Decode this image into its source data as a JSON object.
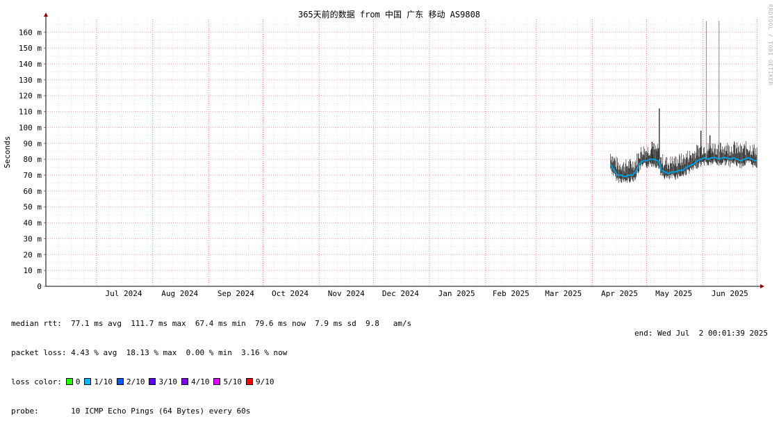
{
  "chart_data": {
    "type": "line",
    "title": "365天前的数据 from 中国 广东 移动 AS9808",
    "ylabel": "Seconds",
    "ylim": [
      0,
      168
    ],
    "y_unit": "ms",
    "y_ticks": [
      "0",
      "10 m",
      "20 m",
      "30 m",
      "40 m",
      "50 m",
      "60 m",
      "70 m",
      "80 m",
      "90 m",
      "100 m",
      "110 m",
      "120 m",
      "130 m",
      "140 m",
      "150 m",
      "160 m"
    ],
    "x_range": [
      "2024-06-03",
      "2025-07-02"
    ],
    "x_tick_labels": [
      {
        "date": "2024-07-16",
        "label": "Jul 2024"
      },
      {
        "date": "2024-08-16",
        "label": "Aug 2024"
      },
      {
        "date": "2024-09-16",
        "label": "Sep 2024"
      },
      {
        "date": "2024-10-16",
        "label": "Oct 2024"
      },
      {
        "date": "2024-11-16",
        "label": "Nov 2024"
      },
      {
        "date": "2024-12-16",
        "label": "Dec 2024"
      },
      {
        "date": "2025-01-16",
        "label": "Jan 2025"
      },
      {
        "date": "2025-02-15",
        "label": "Feb 2025"
      },
      {
        "date": "2025-03-16",
        "label": "Mar 2025"
      },
      {
        "date": "2025-04-16",
        "label": "Apr 2025"
      },
      {
        "date": "2025-05-16",
        "label": "May 2025"
      },
      {
        "date": "2025-06-16",
        "label": "Jun 2025"
      }
    ],
    "month_gridlines": [
      "2024-07-01",
      "2024-08-01",
      "2024-09-01",
      "2024-10-01",
      "2024-11-01",
      "2024-12-01",
      "2025-01-01",
      "2025-02-01",
      "2025-03-01",
      "2025-04-01",
      "2025-05-01",
      "2025-06-01",
      "2025-07-01"
    ],
    "grid": true,
    "series": [
      {
        "color": "#00a0e0",
        "points": [
          [
            "2025-04-11",
            77
          ],
          [
            "2025-04-13",
            73
          ],
          [
            "2025-04-15",
            70
          ],
          [
            "2025-04-17",
            70
          ],
          [
            "2025-04-19",
            69
          ],
          [
            "2025-04-21",
            70
          ],
          [
            "2025-04-23",
            70
          ],
          [
            "2025-04-25",
            72
          ],
          [
            "2025-04-27",
            77
          ],
          [
            "2025-04-29",
            79
          ],
          [
            "2025-05-01",
            79
          ],
          [
            "2025-05-03",
            80
          ],
          [
            "2025-05-05",
            80
          ],
          [
            "2025-05-07",
            79
          ],
          [
            "2025-05-08",
            78
          ],
          [
            "2025-05-09",
            73
          ],
          [
            "2025-05-11",
            72
          ],
          [
            "2025-05-13",
            71
          ],
          [
            "2025-05-15",
            72
          ],
          [
            "2025-05-17",
            72
          ],
          [
            "2025-05-19",
            73
          ],
          [
            "2025-05-21",
            73
          ],
          [
            "2025-05-23",
            75
          ],
          [
            "2025-05-25",
            76
          ],
          [
            "2025-05-27",
            77
          ],
          [
            "2025-05-29",
            79
          ],
          [
            "2025-05-31",
            80
          ],
          [
            "2025-06-02",
            81
          ],
          [
            "2025-06-04",
            80
          ],
          [
            "2025-06-06",
            81
          ],
          [
            "2025-06-08",
            81
          ],
          [
            "2025-06-10",
            80
          ],
          [
            "2025-06-12",
            81
          ],
          [
            "2025-06-14",
            81
          ],
          [
            "2025-06-16",
            80
          ],
          [
            "2025-06-18",
            81
          ],
          [
            "2025-06-20",
            80
          ],
          [
            "2025-06-22",
            79
          ],
          [
            "2025-06-24",
            80
          ],
          [
            "2025-06-26",
            81
          ],
          [
            "2025-06-28",
            80
          ],
          [
            "2025-06-30",
            79
          ],
          [
            "2025-07-01",
            79
          ]
        ]
      }
    ],
    "spikes": [
      {
        "date": "2025-05-08",
        "value": 112
      },
      {
        "date": "2025-05-31",
        "value": 98
      },
      {
        "date": "2025-06-03",
        "value": 167
      },
      {
        "date": "2025-06-10",
        "value": 167
      },
      {
        "date": "2025-05-04",
        "value": 91
      },
      {
        "date": "2025-06-05",
        "value": 95
      }
    ]
  },
  "legend": {
    "median_label": "median rtt:",
    "median_text": "77.1 ms avg  111.7 ms max  67.4 ms min  79.6 ms now  7.9 ms sd  9.8   am/s",
    "loss_label": "packet loss:",
    "loss_text": "4.43 % avg  18.13 % max  0.00 % min  3.16 % now",
    "color_label": "loss color:",
    "colors": [
      {
        "label": "0",
        "color": "#26ff00"
      },
      {
        "label": "1/10",
        "color": "#00b8ff"
      },
      {
        "label": "2/10",
        "color": "#0059ff"
      },
      {
        "label": "3/10",
        "color": "#5e00ff"
      },
      {
        "label": "4/10",
        "color": "#7e00ff"
      },
      {
        "label": "5/10",
        "color": "#dd00ff"
      },
      {
        "label": "9/10",
        "color": "#ff0000"
      }
    ],
    "probe_label": "probe:",
    "probe_text": "10 ICMP Echo Pings (64 Bytes) every 60s"
  },
  "end_text": "end: Wed Jul  2 00:01:39 2025",
  "watermark": "RRDTOOL / TOBI OETIKER"
}
